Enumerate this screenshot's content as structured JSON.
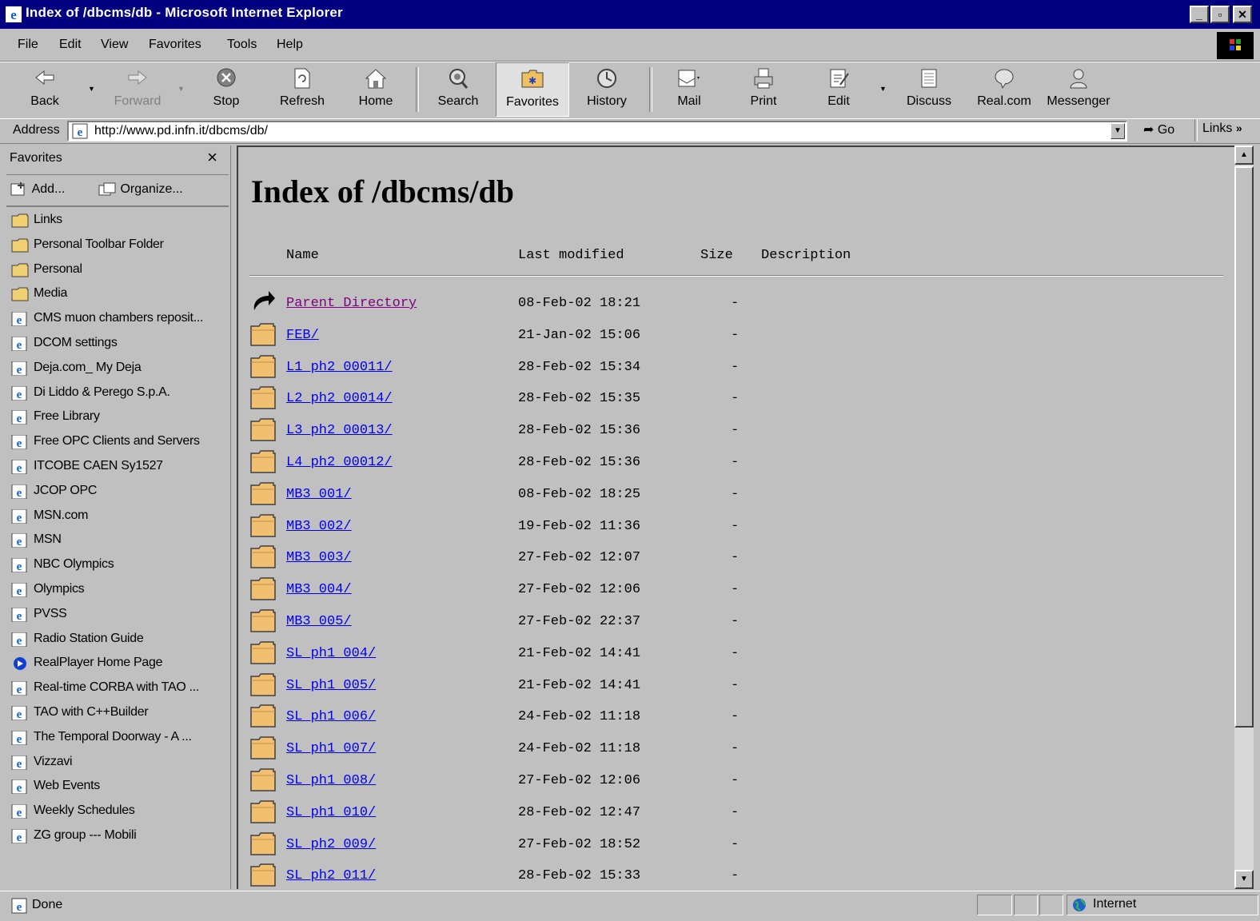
{
  "window": {
    "title": "Index of /dbcms/db - Microsoft Internet Explorer",
    "controls": [
      "minimize",
      "maximize",
      "close"
    ]
  },
  "menu": [
    "File",
    "Edit",
    "View",
    "Favorites",
    "Tools",
    "Help"
  ],
  "toolbar": {
    "back": "Back",
    "forward": "Forward",
    "stop": "Stop",
    "refresh": "Refresh",
    "home": "Home",
    "search": "Search",
    "favorites": "Favorites",
    "history": "History",
    "mail": "Mail",
    "print": "Print",
    "edit": "Edit",
    "discuss": "Discuss",
    "realcom": "Real.com",
    "messenger": "Messenger"
  },
  "address": {
    "label": "Address",
    "url": "http://www.pd.infn.it/dbcms/db/",
    "go": "Go",
    "links": "Links"
  },
  "favorites": {
    "title": "Favorites",
    "add": "Add...",
    "organize": "Organize...",
    "items": [
      {
        "label": "Links",
        "icon": "folder-icon"
      },
      {
        "label": "Personal Toolbar Folder",
        "icon": "folder-icon"
      },
      {
        "label": "Personal",
        "icon": "folder-icon"
      },
      {
        "label": "Media",
        "icon": "folder-icon"
      },
      {
        "label": "CMS muon chambers reposit...",
        "icon": "ie-page-icon"
      },
      {
        "label": "DCOM settings",
        "icon": "ie-page-icon"
      },
      {
        "label": "Deja.com_ My Deja",
        "icon": "ie-page-icon"
      },
      {
        "label": "Di Liddo & Perego S.p.A.",
        "icon": "ie-page-icon"
      },
      {
        "label": "Free Library",
        "icon": "ie-page-icon"
      },
      {
        "label": "Free OPC Clients and Servers",
        "icon": "ie-page-icon"
      },
      {
        "label": "ITCOBE CAEN Sy1527",
        "icon": "ie-page-icon"
      },
      {
        "label": "JCOP OPC",
        "icon": "ie-page-icon"
      },
      {
        "label": "MSN.com",
        "icon": "ie-page-icon"
      },
      {
        "label": "MSN",
        "icon": "ie-page-icon"
      },
      {
        "label": "NBC Olympics",
        "icon": "ie-page-icon"
      },
      {
        "label": "Olympics",
        "icon": "ie-page-icon"
      },
      {
        "label": "PVSS",
        "icon": "ie-page-icon"
      },
      {
        "label": "Radio Station Guide",
        "icon": "ie-page-icon"
      },
      {
        "label": "RealPlayer Home Page",
        "icon": "realplayer-icon"
      },
      {
        "label": "Real-time CORBA with TAO ...",
        "icon": "ie-page-icon"
      },
      {
        "label": "TAO with C++Builder",
        "icon": "ie-page-icon"
      },
      {
        "label": "The Temporal Doorway - A ...",
        "icon": "ie-page-icon"
      },
      {
        "label": "Vizzavi",
        "icon": "ie-page-icon"
      },
      {
        "label": "Web Events",
        "icon": "ie-page-icon"
      },
      {
        "label": "Weekly Schedules",
        "icon": "ie-page-icon"
      },
      {
        "label": "ZG group --- Mobili",
        "icon": "ie-page-icon"
      }
    ]
  },
  "page": {
    "title": "Index of /dbcms/db",
    "headers": {
      "name": "Name",
      "modified": "Last modified",
      "size": "Size",
      "description": "Description"
    },
    "rows": [
      {
        "name": "Parent Directory",
        "modified": "08-Feb-02 18:21",
        "size": "-",
        "icon": "parent-dir-icon",
        "visited": true
      },
      {
        "name": "FEB/",
        "modified": "21-Jan-02 15:06",
        "size": "-",
        "icon": "folder-icon"
      },
      {
        "name": "L1_ph2_00011/",
        "modified": "28-Feb-02 15:34",
        "size": "-",
        "icon": "folder-icon"
      },
      {
        "name": "L2_ph2_00014/",
        "modified": "28-Feb-02 15:35",
        "size": "-",
        "icon": "folder-icon"
      },
      {
        "name": "L3_ph2_00013/",
        "modified": "28-Feb-02 15:36",
        "size": "-",
        "icon": "folder-icon"
      },
      {
        "name": "L4_ph2_00012/",
        "modified": "28-Feb-02 15:36",
        "size": "-",
        "icon": "folder-icon"
      },
      {
        "name": "MB3_001/",
        "modified": "08-Feb-02 18:25",
        "size": "-",
        "icon": "folder-icon"
      },
      {
        "name": "MB3_002/",
        "modified": "19-Feb-02 11:36",
        "size": "-",
        "icon": "folder-icon"
      },
      {
        "name": "MB3_003/",
        "modified": "27-Feb-02 12:07",
        "size": "-",
        "icon": "folder-icon"
      },
      {
        "name": "MB3_004/",
        "modified": "27-Feb-02 12:06",
        "size": "-",
        "icon": "folder-icon"
      },
      {
        "name": "MB3_005/",
        "modified": "27-Feb-02 22:37",
        "size": "-",
        "icon": "folder-icon"
      },
      {
        "name": "SL_ph1_004/",
        "modified": "21-Feb-02 14:41",
        "size": "-",
        "icon": "folder-icon"
      },
      {
        "name": "SL_ph1_005/",
        "modified": "21-Feb-02 14:41",
        "size": "-",
        "icon": "folder-icon"
      },
      {
        "name": "SL_ph1_006/",
        "modified": "24-Feb-02 11:18",
        "size": "-",
        "icon": "folder-icon"
      },
      {
        "name": "SL_ph1_007/",
        "modified": "24-Feb-02 11:18",
        "size": "-",
        "icon": "folder-icon"
      },
      {
        "name": "SL_ph1_008/",
        "modified": "27-Feb-02 12:06",
        "size": "-",
        "icon": "folder-icon"
      },
      {
        "name": "SL_ph1_010/",
        "modified": "28-Feb-02 12:47",
        "size": "-",
        "icon": "folder-icon"
      },
      {
        "name": "SL_ph2_009/",
        "modified": "27-Feb-02 18:52",
        "size": "-",
        "icon": "folder-icon"
      },
      {
        "name": "SL_ph2_011/",
        "modified": "28-Feb-02 15:33",
        "size": "-",
        "icon": "folder-icon"
      }
    ]
  },
  "status": {
    "text": "Done",
    "zone": "Internet"
  },
  "colors": {
    "titlebar": "#000080",
    "face": "#c0c0c0",
    "link": "#0000ee",
    "visited": "#800080",
    "folder": "#f0c070"
  }
}
